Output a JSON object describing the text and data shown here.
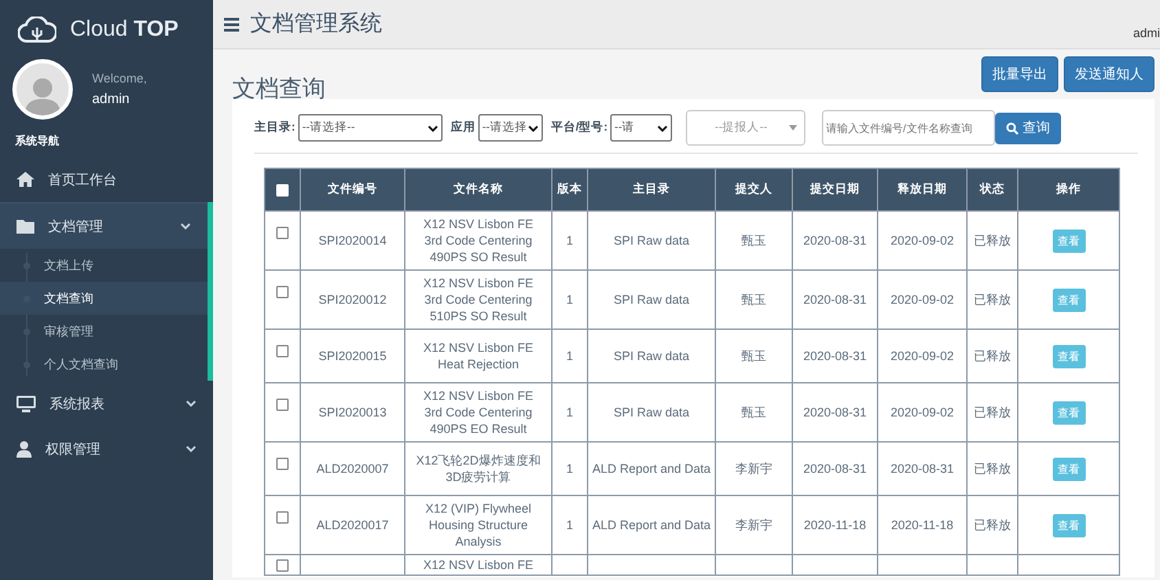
{
  "sidebar": {
    "logo": "Cloud **TOP**",
    "welcome": "Welcome,",
    "user": "admin",
    "section": "系统导航",
    "items": [
      {
        "label": "首页工作台"
      },
      {
        "label": "文档管理",
        "expanded": true,
        "children": [
          {
            "label": "文档上传",
            "selected": false
          },
          {
            "label": "文档查询",
            "selected": true
          },
          {
            "label": "审核管理",
            "selected": false
          },
          {
            "label": "个人文档查询",
            "selected": false
          }
        ]
      },
      {
        "label": "系统报表",
        "expanded": false
      },
      {
        "label": "权限管理",
        "expanded": false
      }
    ]
  },
  "header": {
    "title": "文档管理系统",
    "user": "admi"
  },
  "page": {
    "title": "文档查询",
    "buttons": [
      "批量导出",
      "发送通知人"
    ]
  },
  "filters": {
    "selects": [
      {
        "label": "主目录:",
        "value": "--请选择--"
      },
      {
        "label": "应用",
        "value": "--请选择"
      },
      {
        "label": "平台/型号:",
        "value": "--请"
      }
    ],
    "reporter": {
      "placeholder": "--提报人--"
    },
    "search": {
      "placeholder": "请输入文件编号/文件名称查询"
    },
    "search_button": "查询"
  },
  "table": {
    "select_all": {
      "checked": false
    },
    "columns": [
      "文件编号",
      "文件名称",
      "版本",
      "主目录",
      "提交人",
      "提交日期",
      "释放日期",
      "状态",
      "操作"
    ],
    "rows": [
      {
        "checked": false,
        "cells": [
          "SPI2020014",
          "X12 NSV Lisbon FE 3rd Code Centering 490PS SO Result",
          "1",
          "SPI Raw data",
          "甄玉",
          "2020-08-31",
          "2020-09-02",
          "已释放"
        ],
        "action": "查看"
      },
      {
        "checked": false,
        "cells": [
          "SPI2020012",
          "X12 NSV Lisbon FE 3rd Code Centering 510PS SO Result",
          "1",
          "SPI Raw data",
          "甄玉",
          "2020-08-31",
          "2020-09-02",
          "已释放"
        ],
        "action": "查看"
      },
      {
        "checked": false,
        "cells": [
          "SPI2020015",
          "X12 NSV Lisbon FE Heat Rejection",
          "1",
          "SPI Raw data",
          "甄玉",
          "2020-08-31",
          "2020-09-02",
          "已释放"
        ],
        "action": "查看"
      },
      {
        "checked": false,
        "cells": [
          "SPI2020013",
          "X12 NSV Lisbon FE 3rd Code Centering 490PS EO Result",
          "1",
          "SPI Raw data",
          "甄玉",
          "2020-08-31",
          "2020-09-02",
          "已释放"
        ],
        "action": "查看"
      },
      {
        "checked": false,
        "cells": [
          "ALD2020007",
          "X12飞轮2D爆炸速度和3D疲劳计算",
          "1",
          "ALD Report and Data",
          "李新宇",
          "2020-08-31",
          "2020-08-31",
          "已释放"
        ],
        "action": "查看"
      },
      {
        "checked": false,
        "cells": [
          "ALD2020017",
          "X12 (VIP) Flywheel Housing Structure Analysis",
          "1",
          "ALD Report and Data",
          "李新宇",
          "2020-11-18",
          "2020-11-18",
          "已释放"
        ],
        "action": "查看"
      },
      {
        "checked": false,
        "cells": [
          "",
          "X12 NSV Lisbon FE",
          "",
          "",
          "",
          "",
          "",
          ""
        ]
      }
    ]
  }
}
